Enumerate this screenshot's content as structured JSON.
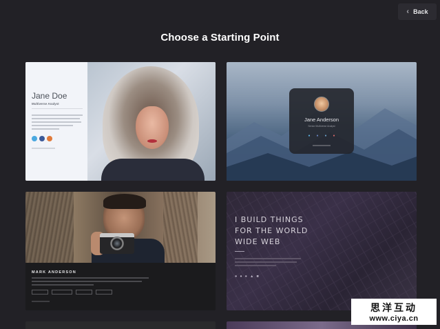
{
  "header": {
    "back_label": "Back",
    "back_icon": "chevron-left-icon",
    "title": "Choose a Starting Point"
  },
  "templates": [
    {
      "name": "Jane Doe",
      "subtitle": "Multiverse Analyst",
      "socials": [
        "twitter-icon",
        "facebook-icon",
        "instagram-icon"
      ],
      "accent_colors": [
        "#4aa8e0",
        "#3b5998",
        "#e07a3a"
      ]
    },
    {
      "name": "Jane Anderson",
      "subtitle": "Senior Multiverse Analyst",
      "socials": [
        "twitter-icon",
        "facebook-icon",
        "instagram-icon",
        "mail-icon"
      ]
    },
    {
      "name": "MARK ANDERSON",
      "tags": 4
    },
    {
      "headline": [
        "I BUILD THINGS",
        "FOR THE WORLD",
        "WIDE WEB"
      ],
      "socials": [
        "twitter-icon",
        "github-icon",
        "dribbble-icon",
        "codepen-icon",
        "mail-icon"
      ]
    }
  ],
  "watermark": {
    "line1": "思洋互动",
    "line2": "www.ciya.cn"
  }
}
